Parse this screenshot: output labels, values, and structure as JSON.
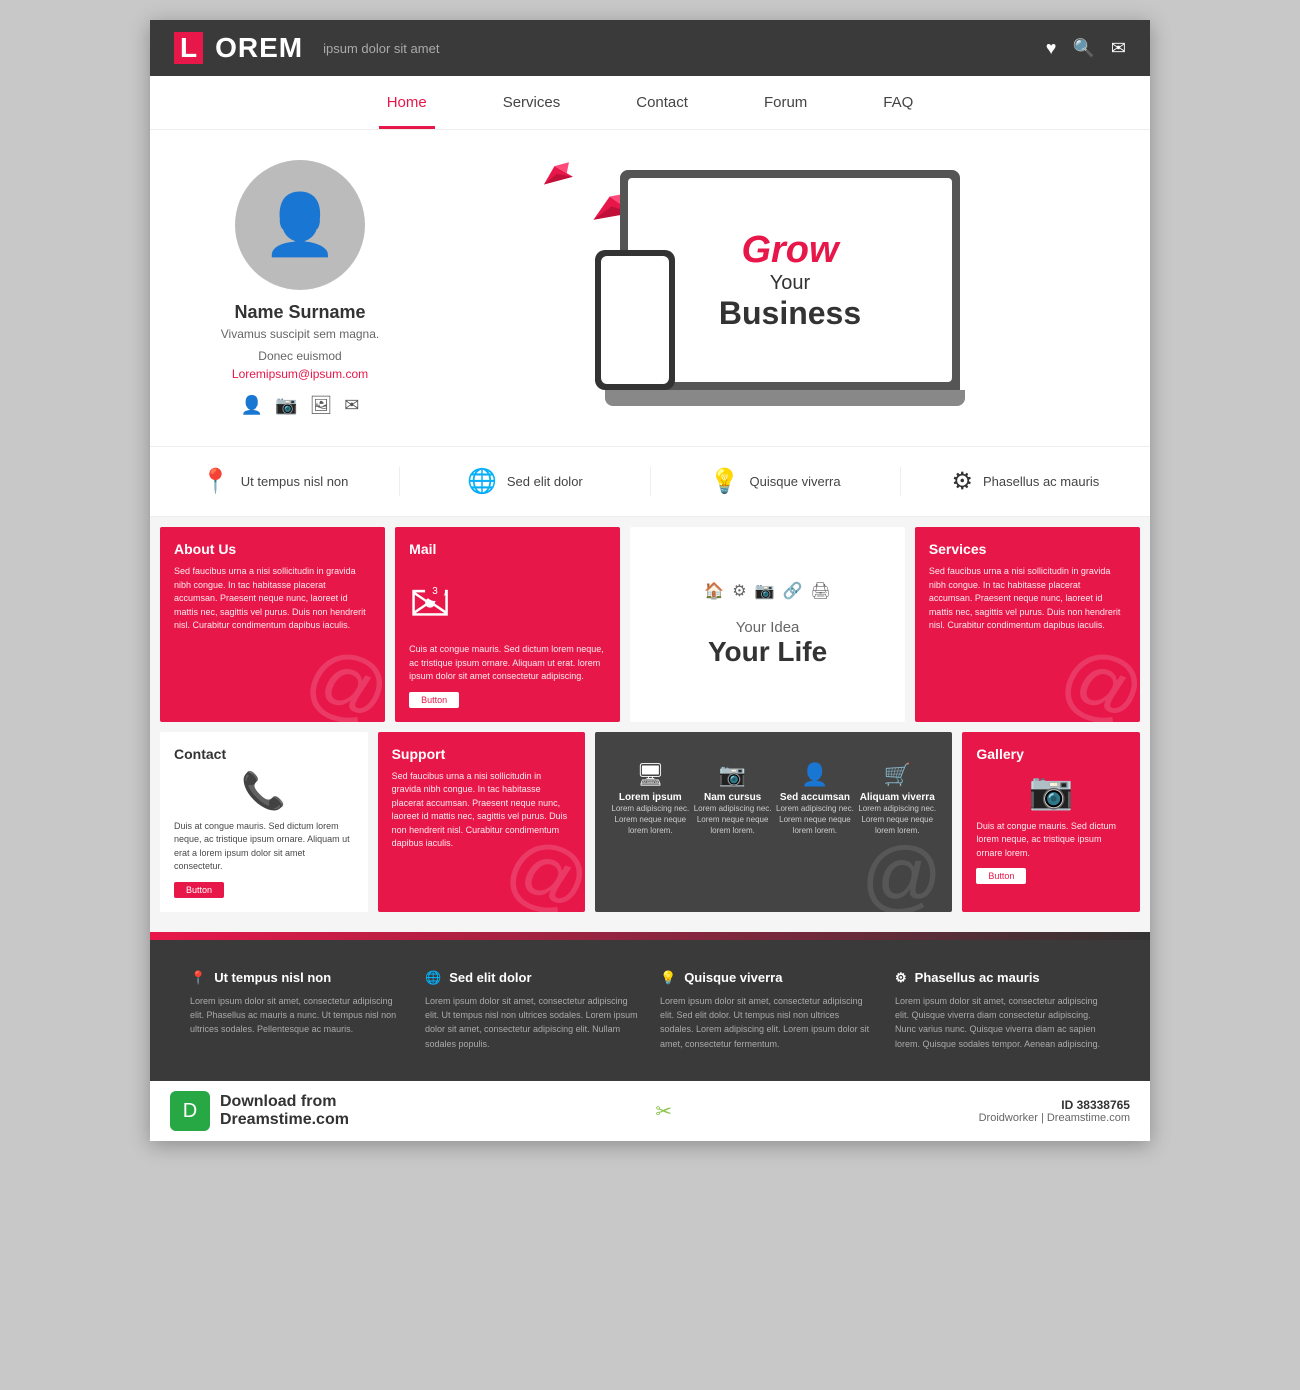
{
  "header": {
    "logo_l": "L",
    "logo_rest": "OREM",
    "tagline": "ipsum dolor sit amet"
  },
  "nav": {
    "items": [
      {
        "label": "Home",
        "active": true
      },
      {
        "label": "Services",
        "active": false
      },
      {
        "label": "Contact",
        "active": false
      },
      {
        "label": "Forum",
        "active": false
      },
      {
        "label": "FAQ",
        "active": false
      }
    ]
  },
  "hero": {
    "profile_name": "Name Surname",
    "profile_desc": "Vivamus suscipit sem magna.",
    "profile_sub": "Donec euismod",
    "profile_email": "Loremipsum@ipsum.com",
    "grow": "Grow",
    "your": "Your",
    "business": "Business"
  },
  "features": [
    {
      "icon": "📍",
      "text": "Ut tempus nisl non"
    },
    {
      "icon": "🌐",
      "text": "Sed elit dolor"
    },
    {
      "icon": "💡",
      "text": "Quisque viverra"
    },
    {
      "icon": "⚙",
      "text": "Phasellus ac mauris"
    }
  ],
  "grid": {
    "row1": {
      "about_title": "About Us",
      "about_text": "Sed faucibus urna a nisi sollicitudin in gravida nibh congue. In tac habitasse placerat accumsan. Praesent neque nunc, laoreet id mattis nec, sagittis vel purus. Duis non hendrerit nisl. Curabitur condimentum dapibus iaculis.",
      "mail_title": "Mail",
      "mail_text": "Cuis at congue mauris. Sed dictum lorem neque, ac tristique ipsum ornare. Aliquam ut erat. lorem ipsum dolor sit amet consectetur adipiscing.",
      "mail_badge": "3",
      "mail_button": "Button",
      "idea_text": "Your Idea",
      "life_text": "Your Life",
      "services_title": "Services",
      "services_text": "Sed faucibus urna a nisi sollicitudin in gravida nibh congue. In tac habitasse placerat accumsan. Praesent neque nunc, laoreet id mattis nec, sagittis vel purus. Duis non hendrerit nisl. Curabitur condimentum dapibus iaculis."
    },
    "row2": {
      "contact_title": "Contact",
      "contact_text": "Duis at congue mauris. Sed dictum lorem neque, ac tristique ipsum ornare. Aliquam ut erat a lorem ipsum dolor sit amet consectetur.",
      "contact_button": "Button",
      "support_title": "Support",
      "support_text": "Sed faucibus urna a nisi sollicitudin in gravida nibh congue. In tac habitasse placerat accumsan. Praesent neque nunc, laoreet id mattis nec, sagittis vel purus. Duis non hendrerit nisl. Curabitur condimentum dapibus iaculis.",
      "dark_items": [
        {
          "icon": "🖥",
          "title": "Lorem ipsum",
          "text": "Lorem adipiscing nec. Lorem neque neque lorem lorem."
        },
        {
          "icon": "📷",
          "title": "Nam cursus",
          "text": "Lorem adipiscing nec. Lorem neque neque lorem lorem."
        },
        {
          "icon": "👤",
          "title": "Sed accumsan",
          "text": "Lorem adipiscing nec. Lorem neque neque lorem lorem."
        },
        {
          "icon": "🛒",
          "title": "Aliquam viverra",
          "text": "Lorem adipiscing nec. Lorem neque neque lorem lorem."
        }
      ],
      "gallery_title": "Gallery",
      "gallery_button": "Button"
    }
  },
  "footer": {
    "cols": [
      {
        "icon": "📍",
        "title": "Ut tempus nisl non",
        "text": "Lorem ipsum dolor sit amet, consectetur adipiscing elit. Phasellus ac mauris a nunc. Ut tempus nisl non ultrices sodales. Pellentesque ac mauris."
      },
      {
        "icon": "🌐",
        "title": "Sed elit dolor",
        "text": "Lorem ipsum dolor sit amet, consectetur adipiscing elit. Ut tempus nisl non ultrices sodales. Lorem ipsum dolor sit amet, consectetur adipiscing elit. Nullam sodales populis."
      },
      {
        "icon": "💡",
        "title": "Quisque viverra",
        "text": "Lorem ipsum dolor sit amet, consectetur adipiscing elit. Sed elit dolor. Ut tempus nisl non ultrices sodales. Lorem adipiscing elit. Lorem ipsum dolor sit amet, consectetur fermentum."
      },
      {
        "icon": "⚙",
        "title": "Phasellus ac mauris",
        "text": "Lorem ipsum dolor sit amet, consectetur adipiscing elit. Quisque viverra diam consectetur adipiscing. Nunc varius nunc. Quisque viverra diam ac sapien lorem. Quisque sodales tempor. Aenean adipiscing."
      }
    ]
  },
  "watermark": {
    "download_text": "Download from",
    "site_name": "Dreamstime.com",
    "id_label": "ID",
    "id_value": "38338765",
    "attribution": "Droidworker | Dreamstime.com"
  }
}
